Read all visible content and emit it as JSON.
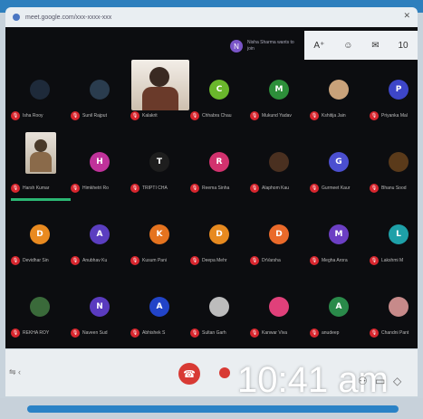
{
  "browser": {
    "url": "meet.google.com/xxx-xxxx-xxx"
  },
  "notification": {
    "initial": "N",
    "text": "Nisha Sharma wants to join"
  },
  "toolbar": {
    "icons": [
      "text-size-icon",
      "people-icon",
      "chat-icon",
      "activities-icon"
    ],
    "count_badge": "10"
  },
  "colors": {
    "mic_off": "#d8262e",
    "end_call": "#d83a34",
    "stage_bg": "#0c0d10"
  },
  "participants": [
    {
      "initial": "",
      "name": "Isha Rooy",
      "color": "#1e2a3a"
    },
    {
      "initial": "",
      "name": "Sunil Rajput",
      "color": "#2a3c4e"
    },
    {
      "initial": "",
      "name": "Kalakrit",
      "color": "#3a2a22"
    },
    {
      "initial": "C",
      "name": "Chhabra Chau",
      "color": "#6ab72c"
    },
    {
      "initial": "M",
      "name": "Mukund Yadav",
      "color": "#2d8f3a"
    },
    {
      "initial": "",
      "name": "Kshitija Jain",
      "color": "#c9a27a"
    },
    {
      "initial": "P",
      "name": "Priyanka Mal",
      "color": "#3d46c8"
    },
    {
      "initial": "",
      "name": "Harsh Kumar",
      "color": "#3b3b3b"
    },
    {
      "initial": "H",
      "name": "Himkhetri Ro",
      "color": "#c0329a"
    },
    {
      "initial": "T",
      "name": "TRIPTI CHA",
      "color": "#1e1e1e"
    },
    {
      "initial": "R",
      "name": "Reema Sinha",
      "color": "#d2326e"
    },
    {
      "initial": "",
      "name": "Alaphom Kau",
      "color": "#4a3020"
    },
    {
      "initial": "G",
      "name": "Gurmeet Kaur",
      "color": "#4b4fd0"
    },
    {
      "initial": "",
      "name": "Bhanu Sood",
      "color": "#5a3a1a"
    },
    {
      "initial": "D",
      "name": "Devidhar Sin",
      "color": "#e98a20"
    },
    {
      "initial": "A",
      "name": "Anubhav Ku",
      "color": "#5b3ec0"
    },
    {
      "initial": "K",
      "name": "Kusum Pani",
      "color": "#e5731f"
    },
    {
      "initial": "D",
      "name": "Deepa Mehr",
      "color": "#e78a20"
    },
    {
      "initial": "D",
      "name": "DrVarsha",
      "color": "#ea6a2a"
    },
    {
      "initial": "M",
      "name": "Megha Arora",
      "color": "#6c3fc4"
    },
    {
      "initial": "L",
      "name": "Lakshmi M",
      "color": "#1ea0a8"
    },
    {
      "initial": "",
      "name": "REKHA ROY",
      "color": "#3a6a3a"
    },
    {
      "initial": "N",
      "name": "Naveen Sud",
      "color": "#5a3bbf"
    },
    {
      "initial": "A",
      "name": "Abhishek S",
      "color": "#2244c8"
    },
    {
      "initial": "",
      "name": "Sultan Garh",
      "color": "#bcbcbc"
    },
    {
      "initial": "",
      "name": "Kanwar Viva",
      "color": "#e0407a"
    },
    {
      "initial": "A",
      "name": "anudeep",
      "color": "#2a8a4a"
    },
    {
      "initial": "",
      "name": "Chandni Pant",
      "color": "#c78a8a"
    }
  ],
  "clock": "10:41 am",
  "bottom_icons": [
    "info-icon",
    "people-icon",
    "chat-icon",
    "activities-icon"
  ]
}
